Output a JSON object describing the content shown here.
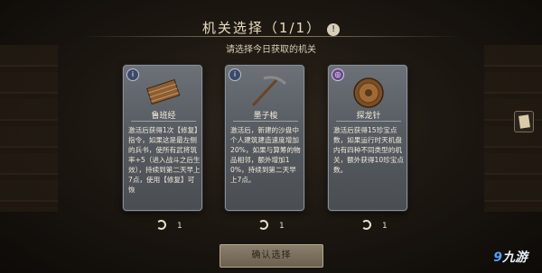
{
  "header": {
    "title": "机关选择（1/1）",
    "info_icon": "!"
  },
  "subtitle": "请选择今日获取的机关",
  "cards": [
    {
      "name": "鲁班经",
      "corner_icon": "i",
      "desc": [
        [
          "激活后获得1次【修复】指令，如果这是最左侧的兵书，使所有武将筑率+5（进入战斗之后生效），持续到第二天早上7点，使用【修复】可恢",
          ""
        ]
      ],
      "count": "1"
    },
    {
      "name": "墨子梭",
      "corner_icon": "i",
      "desc": [
        [
          "激活后，新建的沙盘中个人建筑建造速度增加20%，如果与算筹的物品相邻，额外增加10%，持续到第二天早上7点。",
          ""
        ]
      ],
      "count": "1"
    },
    {
      "name": "探龙针",
      "corner_icon": "◎",
      "desc": [
        [
          "激活后获得15珍宝点数，如果运行时天机盘内有四种不同类型的机关，额外获得10珍宝点数。",
          ""
        ]
      ],
      "count": "1"
    }
  ],
  "confirm_label": "确认选择",
  "watermark": "九游"
}
